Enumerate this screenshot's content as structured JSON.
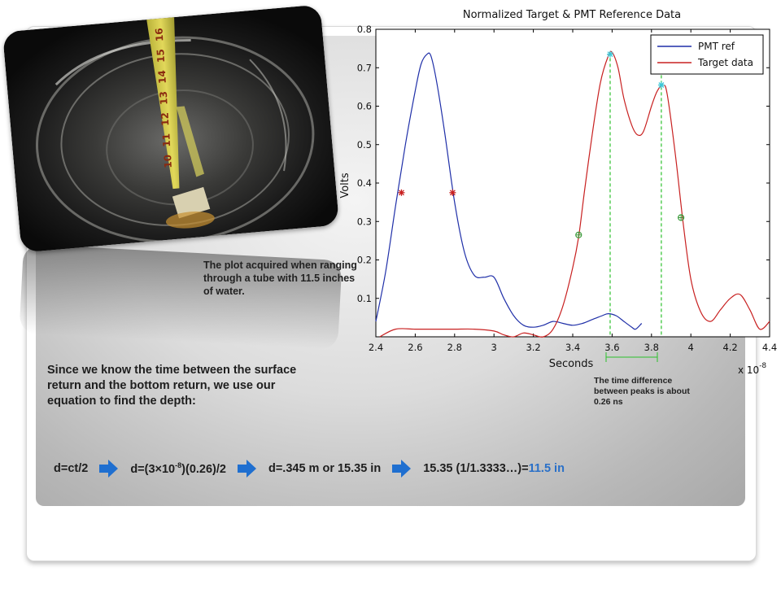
{
  "chart_data": {
    "type": "line",
    "title": "Normalized Target & PMT Reference Data",
    "xlabel": "Seconds",
    "ylabel": "Volts",
    "x_multiplier": "x 10",
    "x_multiplier_exp": "-8",
    "xlim": [
      2.4,
      4.4
    ],
    "ylim": [
      0,
      0.8
    ],
    "x_ticks": [
      "2.4",
      "2.6",
      "2.8",
      "3",
      "3.2",
      "3.4",
      "3.6",
      "3.8",
      "4",
      "4.2",
      "4.4"
    ],
    "y_ticks": [
      "0.1",
      "0.2",
      "0.3",
      "0.4",
      "0.5",
      "0.6",
      "0.7",
      "0.8"
    ],
    "grid": false,
    "legend_position": "top-right",
    "series": [
      {
        "name": "PMT ref",
        "color": "#1f2fa8",
        "x": [
          2.4,
          2.45,
          2.5,
          2.55,
          2.6,
          2.63,
          2.66,
          2.68,
          2.71,
          2.75,
          2.8,
          2.85,
          2.9,
          2.95,
          3.0,
          3.05,
          3.1,
          3.15,
          3.2,
          3.25,
          3.3,
          3.35,
          3.4,
          3.45,
          3.5,
          3.55,
          3.58,
          3.62,
          3.66,
          3.7,
          3.72,
          3.75
        ],
        "y": [
          0.04,
          0.17,
          0.34,
          0.5,
          0.64,
          0.71,
          0.735,
          0.73,
          0.66,
          0.53,
          0.35,
          0.22,
          0.16,
          0.155,
          0.155,
          0.1,
          0.055,
          0.03,
          0.025,
          0.03,
          0.04,
          0.035,
          0.03,
          0.035,
          0.045,
          0.055,
          0.06,
          0.055,
          0.04,
          0.025,
          0.02,
          0.035
        ]
      },
      {
        "name": "Target data",
        "color": "#c82020",
        "x": [
          2.42,
          2.5,
          2.6,
          2.7,
          2.8,
          2.9,
          3.0,
          3.05,
          3.1,
          3.15,
          3.2,
          3.25,
          3.3,
          3.35,
          3.4,
          3.43,
          3.46,
          3.5,
          3.54,
          3.58,
          3.6,
          3.63,
          3.66,
          3.7,
          3.73,
          3.76,
          3.8,
          3.83,
          3.86,
          3.88,
          3.92,
          3.96,
          4.0,
          4.05,
          4.1,
          4.15,
          4.2,
          4.25,
          4.3,
          4.35,
          4.4
        ],
        "y": [
          0.0,
          0.02,
          0.02,
          0.02,
          0.02,
          0.02,
          0.015,
          0.005,
          0.0,
          0.01,
          0.005,
          0.0,
          0.02,
          0.08,
          0.18,
          0.26,
          0.38,
          0.53,
          0.66,
          0.73,
          0.74,
          0.7,
          0.62,
          0.55,
          0.525,
          0.535,
          0.6,
          0.64,
          0.655,
          0.63,
          0.48,
          0.3,
          0.15,
          0.065,
          0.04,
          0.07,
          0.1,
          0.11,
          0.07,
          0.02,
          0.04
        ]
      }
    ],
    "markers": [
      {
        "series": "PMT ref",
        "style": "star",
        "x": 2.53,
        "y": 0.375
      },
      {
        "series": "PMT ref",
        "style": "star",
        "x": 2.79,
        "y": 0.375
      },
      {
        "series": "Target data",
        "style": "circle",
        "x": 3.43,
        "y": 0.265
      },
      {
        "series": "Target data",
        "style": "circle",
        "x": 3.95,
        "y": 0.31
      },
      {
        "series": "Target data",
        "style": "peak",
        "x": 3.59,
        "y": 0.735
      },
      {
        "series": "Target data",
        "style": "peak",
        "x": 3.85,
        "y": 0.655
      }
    ],
    "peak_lines_x": [
      3.59,
      3.85
    ]
  },
  "photo": {
    "tape_numbers": [
      "16",
      "15",
      "14",
      "13",
      "12",
      "11",
      "10"
    ]
  },
  "captions": {
    "photo": "The plot acquired when ranging through a tube with 11.5 inches of water.",
    "depth": "Since we know the time between the surface return and the bottom return, we use our equation to find the depth:",
    "time_diff": "The time difference between peaks is about 0.26 ns"
  },
  "equations": {
    "eq1": "d=ct/2",
    "eq2_pre": "d=(3×10",
    "eq2_exp": "-8",
    "eq2_post": ")(0.26)/2",
    "eq3": "d=.345 m or 15.35 in",
    "eq4": "15.35 (1/1.3333…)=",
    "eq4_result": "11.5 in"
  },
  "colors": {
    "arrow": "#1f6fd0",
    "result": "#2a70c8",
    "peak_line": "#2bc02b",
    "peak_marker": "#3cc8d8"
  }
}
